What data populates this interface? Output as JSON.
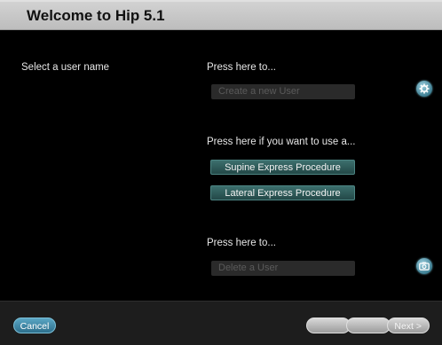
{
  "window": {
    "title": "Welcome to Hip 5.1"
  },
  "left": {
    "select_user_label": "Select a user name"
  },
  "create_section": {
    "prompt": "Press here to...",
    "button_label": "Create a new User"
  },
  "procedure_section": {
    "prompt": "Press here if you want to use a...",
    "supine_label": "Supine Express Procedure",
    "lateral_label": "Lateral Express Procedure"
  },
  "delete_section": {
    "prompt": "Press here to...",
    "button_label": "Delete a User"
  },
  "icons": {
    "settings": "gear-icon",
    "camera": "camera-icon"
  },
  "footer": {
    "cancel_label": "Cancel",
    "back_label": "",
    "middle_label": "",
    "next_label": "Next >"
  },
  "colors": {
    "title_bar": "#c8c8c8",
    "background": "#000000",
    "accent_teal": "#2f5f5d",
    "accent_blue": "#3f8fb0"
  }
}
